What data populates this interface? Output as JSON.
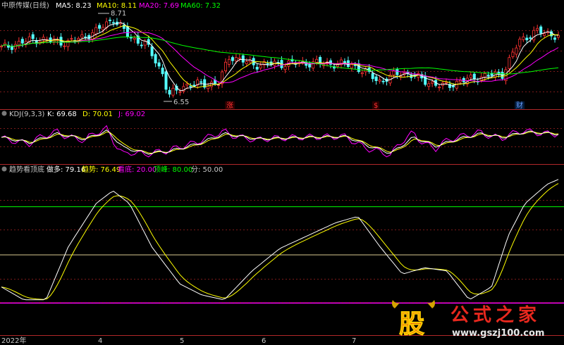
{
  "panels": {
    "main": {
      "title": "中原传媒(日线)",
      "ma": [
        {
          "label": "MA5: 8.23",
          "color": "#ffffff"
        },
        {
          "label": "MA10: 8.11",
          "color": "#ffff00"
        },
        {
          "label": "MA20: 7.69",
          "color": "#ff00ff"
        },
        {
          "label": "MA60: 7.32",
          "color": "#00ff00"
        }
      ],
      "high_marker": "8.71",
      "low_marker": "6.55",
      "events": [
        {
          "text": "涨",
          "color": "#ff3030"
        },
        {
          "text": "$",
          "color": "#ff3030"
        },
        {
          "text": "财",
          "color": "#6aa0ff"
        }
      ]
    },
    "kdj": {
      "title": "KDJ(9,3,3)",
      "items": [
        {
          "label": "K: 69.68",
          "color": "#ffffff"
        },
        {
          "label": "D: 70.01",
          "color": "#ffff00"
        },
        {
          "label": "J: 69.02",
          "color": "#ff00ff"
        }
      ]
    },
    "trend": {
      "title": "趋势看顶底",
      "items": [
        {
          "label": "做多: 79.16",
          "color": "#ffffff"
        },
        {
          "label": "趋势: 76.49",
          "color": "#ffff00"
        },
        {
          "label": "看底: 20.00",
          "color": "#ff00ff"
        },
        {
          "label": "顶峰: 80.00",
          "color": "#00ff00"
        },
        {
          "label": "分: 50.00",
          "color": "#c8c8c8"
        }
      ]
    }
  },
  "x_axis": {
    "labels": [
      "2022年",
      "4",
      "5",
      "6",
      "7"
    ]
  },
  "watermark": {
    "logo_char": "股",
    "text": "公式之家",
    "url": "www.gszj100.com"
  },
  "chart_data": {
    "type": "line",
    "xlabel": "",
    "ylabel": "",
    "x_ticks": [
      "2022年",
      "4",
      "5",
      "6",
      "7"
    ],
    "price": {
      "ylim": [
        6.3,
        8.9
      ],
      "high": 8.71,
      "low": 6.55,
      "series": [
        {
          "name": "MA5",
          "color": "#ffffff",
          "last": 8.23
        },
        {
          "name": "MA10",
          "color": "#ffff00",
          "last": 8.11
        },
        {
          "name": "MA20",
          "color": "#ff00ff",
          "last": 7.69
        },
        {
          "name": "MA60",
          "color": "#00ff00",
          "last": 7.32
        }
      ]
    },
    "kdj": {
      "ylim": [
        -10,
        110
      ],
      "series": [
        {
          "name": "K",
          "color": "#ffffff",
          "last": 69.68
        },
        {
          "name": "D",
          "color": "#ffff00",
          "last": 70.01
        },
        {
          "name": "J",
          "color": "#ff00ff",
          "last": 69.02
        }
      ]
    },
    "trend": {
      "ylim": [
        0,
        100
      ],
      "series": [
        {
          "name": "做多",
          "color": "#ffffff",
          "last": 79.16
        },
        {
          "name": "趋势",
          "color": "#ffff00",
          "last": 76.49
        },
        {
          "name": "看底",
          "color": "#ff00ff",
          "last": 20.0
        },
        {
          "name": "顶峰",
          "color": "#00ff00",
          "last": 80.0
        },
        {
          "name": "分",
          "color": "#c8c8c8",
          "last": 50.0
        }
      ]
    }
  }
}
